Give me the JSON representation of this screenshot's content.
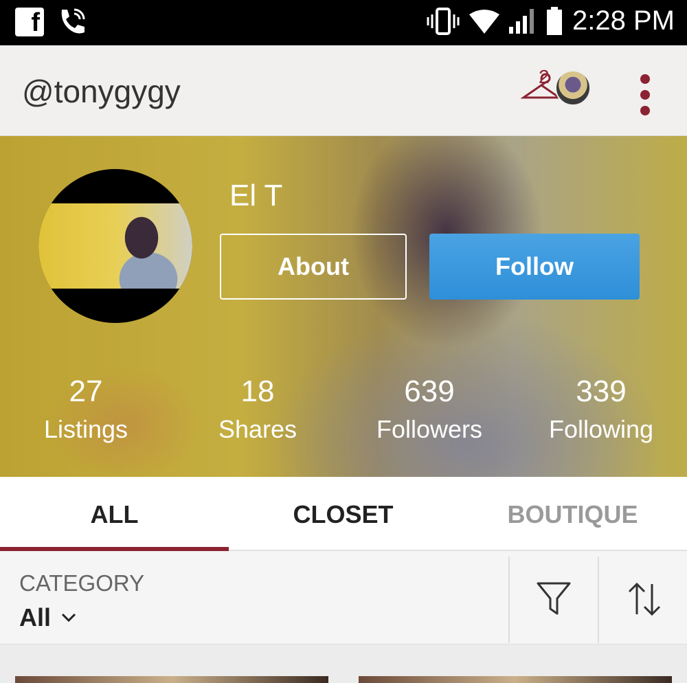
{
  "status_bar": {
    "time": "2:28 PM",
    "left_icons": [
      "facebook-icon",
      "wifi-calling-icon"
    ],
    "right_icons": [
      "vibrate-icon",
      "wifi-icon",
      "signal-icon",
      "battery-icon"
    ]
  },
  "header": {
    "username": "@tonygygy",
    "hanger_badge": "2"
  },
  "profile": {
    "display_name": "El T",
    "about_label": "About",
    "follow_label": "Follow",
    "stats": [
      {
        "value": "27",
        "label": "Listings"
      },
      {
        "value": "18",
        "label": "Shares"
      },
      {
        "value": "639",
        "label": "Followers"
      },
      {
        "value": "339",
        "label": "Following"
      }
    ]
  },
  "tabs": [
    {
      "label": "ALL",
      "active": true
    },
    {
      "label": "CLOSET",
      "active": false
    },
    {
      "label": "BOUTIQUE",
      "active": false
    }
  ],
  "filter": {
    "category_label": "CATEGORY",
    "category_value": "All"
  },
  "colors": {
    "accent": "#8b2332",
    "follow_blue": "#3598dd"
  }
}
